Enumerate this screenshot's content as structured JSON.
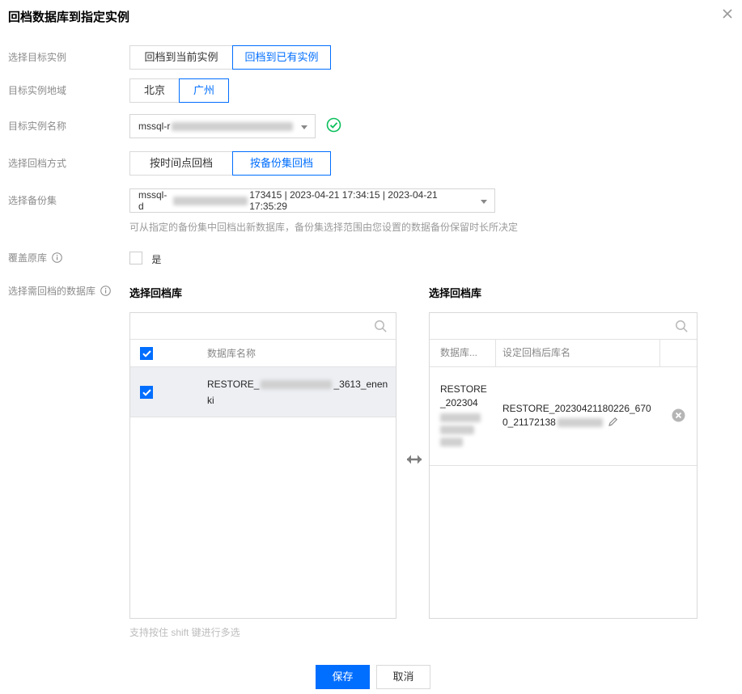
{
  "dialog": {
    "title": "回档数据库到指定实例"
  },
  "form": {
    "target_instance": {
      "label": "选择目标实例",
      "options": [
        {
          "label": "回档到当前实例",
          "selected": false
        },
        {
          "label": "回档到已有实例",
          "selected": true
        }
      ]
    },
    "region": {
      "label": "目标实例地域",
      "options": [
        {
          "label": "北京",
          "selected": false
        },
        {
          "label": "广州",
          "selected": true
        }
      ]
    },
    "instance_name": {
      "label": "目标实例名称",
      "value_prefix": "mssql-r",
      "value_redacted": true,
      "status": "valid"
    },
    "restore_mode": {
      "label": "选择回档方式",
      "options": [
        {
          "label": "按时间点回档",
          "selected": false
        },
        {
          "label": "按备份集回档",
          "selected": true
        }
      ]
    },
    "backup_set": {
      "label": "选择备份集",
      "value_prefix": "mssql-d",
      "value_redacted": true,
      "value_suffix": "173415 | 2023-04-21 17:34:15 | 2023-04-21 17:35:29",
      "hint": "可从指定的备份集中回档出新数据库，备份集选择范围由您设置的数据备份保留时长所决定"
    },
    "overwrite": {
      "label": "覆盖原库",
      "checkbox_label": "是",
      "checked": false
    },
    "database_pick": {
      "label": "选择需回档的数据库"
    }
  },
  "transfer": {
    "left_panel": {
      "title": "选择回档库",
      "search_value": "",
      "column_header": "数据库名称",
      "header_checked": true,
      "row": {
        "checked": true,
        "name_prefix": "RESTORE_",
        "name_redacted": true,
        "name_suffix": "_3613_enenki"
      }
    },
    "right_panel": {
      "title": "选择回档库",
      "search_value": "",
      "column_headers": [
        "数据库...",
        "设定回档后库名"
      ],
      "row": {
        "source_name_visible": "RESTORE_202304",
        "source_redacted": true,
        "target_name_line1": "RESTORE_20230421180226_670",
        "target_name_line2": "0_21172138",
        "target_redacted": true
      }
    },
    "multi_select_hint": "支持按住 shift 键进行多选"
  },
  "footer": {
    "save_label": "保存",
    "cancel_label": "取消"
  },
  "colors": {
    "primary": "#006EFF",
    "success_green": "#0ABF5B"
  }
}
